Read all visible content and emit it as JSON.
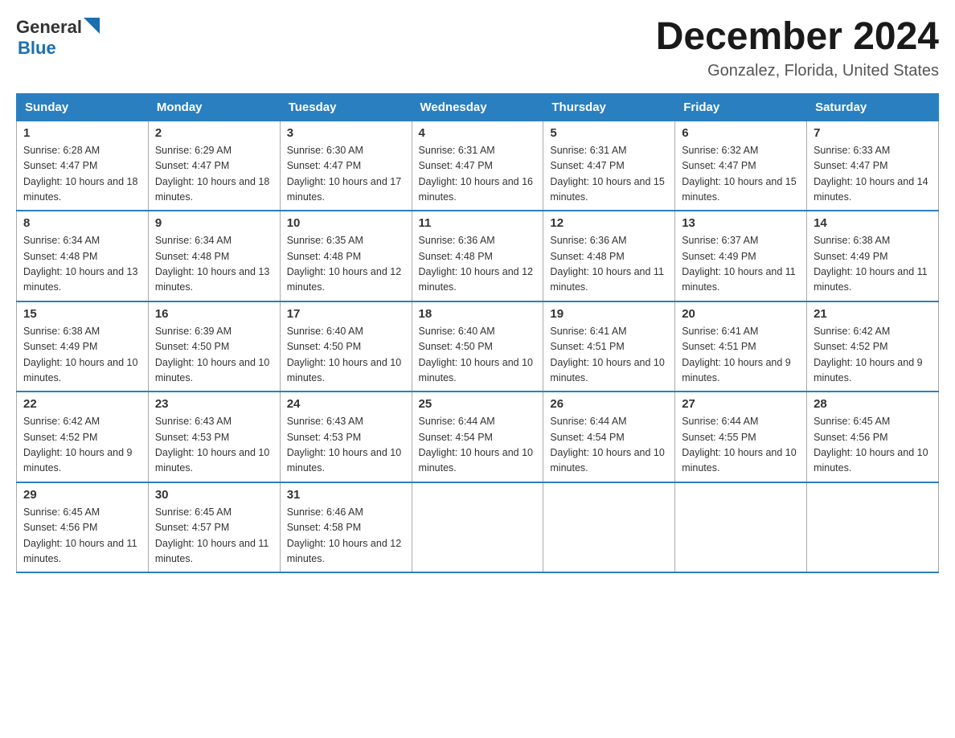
{
  "header": {
    "logo_general": "General",
    "logo_blue": "Blue",
    "month_title": "December 2024",
    "location": "Gonzalez, Florida, United States"
  },
  "days_of_week": [
    "Sunday",
    "Monday",
    "Tuesday",
    "Wednesday",
    "Thursday",
    "Friday",
    "Saturday"
  ],
  "weeks": [
    [
      {
        "day": "1",
        "sunrise": "6:28 AM",
        "sunset": "4:47 PM",
        "daylight": "10 hours and 18 minutes."
      },
      {
        "day": "2",
        "sunrise": "6:29 AM",
        "sunset": "4:47 PM",
        "daylight": "10 hours and 18 minutes."
      },
      {
        "day": "3",
        "sunrise": "6:30 AM",
        "sunset": "4:47 PM",
        "daylight": "10 hours and 17 minutes."
      },
      {
        "day": "4",
        "sunrise": "6:31 AM",
        "sunset": "4:47 PM",
        "daylight": "10 hours and 16 minutes."
      },
      {
        "day": "5",
        "sunrise": "6:31 AM",
        "sunset": "4:47 PM",
        "daylight": "10 hours and 15 minutes."
      },
      {
        "day": "6",
        "sunrise": "6:32 AM",
        "sunset": "4:47 PM",
        "daylight": "10 hours and 15 minutes."
      },
      {
        "day": "7",
        "sunrise": "6:33 AM",
        "sunset": "4:47 PM",
        "daylight": "10 hours and 14 minutes."
      }
    ],
    [
      {
        "day": "8",
        "sunrise": "6:34 AM",
        "sunset": "4:48 PM",
        "daylight": "10 hours and 13 minutes."
      },
      {
        "day": "9",
        "sunrise": "6:34 AM",
        "sunset": "4:48 PM",
        "daylight": "10 hours and 13 minutes."
      },
      {
        "day": "10",
        "sunrise": "6:35 AM",
        "sunset": "4:48 PM",
        "daylight": "10 hours and 12 minutes."
      },
      {
        "day": "11",
        "sunrise": "6:36 AM",
        "sunset": "4:48 PM",
        "daylight": "10 hours and 12 minutes."
      },
      {
        "day": "12",
        "sunrise": "6:36 AM",
        "sunset": "4:48 PM",
        "daylight": "10 hours and 11 minutes."
      },
      {
        "day": "13",
        "sunrise": "6:37 AM",
        "sunset": "4:49 PM",
        "daylight": "10 hours and 11 minutes."
      },
      {
        "day": "14",
        "sunrise": "6:38 AM",
        "sunset": "4:49 PM",
        "daylight": "10 hours and 11 minutes."
      }
    ],
    [
      {
        "day": "15",
        "sunrise": "6:38 AM",
        "sunset": "4:49 PM",
        "daylight": "10 hours and 10 minutes."
      },
      {
        "day": "16",
        "sunrise": "6:39 AM",
        "sunset": "4:50 PM",
        "daylight": "10 hours and 10 minutes."
      },
      {
        "day": "17",
        "sunrise": "6:40 AM",
        "sunset": "4:50 PM",
        "daylight": "10 hours and 10 minutes."
      },
      {
        "day": "18",
        "sunrise": "6:40 AM",
        "sunset": "4:50 PM",
        "daylight": "10 hours and 10 minutes."
      },
      {
        "day": "19",
        "sunrise": "6:41 AM",
        "sunset": "4:51 PM",
        "daylight": "10 hours and 10 minutes."
      },
      {
        "day": "20",
        "sunrise": "6:41 AM",
        "sunset": "4:51 PM",
        "daylight": "10 hours and 9 minutes."
      },
      {
        "day": "21",
        "sunrise": "6:42 AM",
        "sunset": "4:52 PM",
        "daylight": "10 hours and 9 minutes."
      }
    ],
    [
      {
        "day": "22",
        "sunrise": "6:42 AM",
        "sunset": "4:52 PM",
        "daylight": "10 hours and 9 minutes."
      },
      {
        "day": "23",
        "sunrise": "6:43 AM",
        "sunset": "4:53 PM",
        "daylight": "10 hours and 10 minutes."
      },
      {
        "day": "24",
        "sunrise": "6:43 AM",
        "sunset": "4:53 PM",
        "daylight": "10 hours and 10 minutes."
      },
      {
        "day": "25",
        "sunrise": "6:44 AM",
        "sunset": "4:54 PM",
        "daylight": "10 hours and 10 minutes."
      },
      {
        "day": "26",
        "sunrise": "6:44 AM",
        "sunset": "4:54 PM",
        "daylight": "10 hours and 10 minutes."
      },
      {
        "day": "27",
        "sunrise": "6:44 AM",
        "sunset": "4:55 PM",
        "daylight": "10 hours and 10 minutes."
      },
      {
        "day": "28",
        "sunrise": "6:45 AM",
        "sunset": "4:56 PM",
        "daylight": "10 hours and 10 minutes."
      }
    ],
    [
      {
        "day": "29",
        "sunrise": "6:45 AM",
        "sunset": "4:56 PM",
        "daylight": "10 hours and 11 minutes."
      },
      {
        "day": "30",
        "sunrise": "6:45 AM",
        "sunset": "4:57 PM",
        "daylight": "10 hours and 11 minutes."
      },
      {
        "day": "31",
        "sunrise": "6:46 AM",
        "sunset": "4:58 PM",
        "daylight": "10 hours and 12 minutes."
      },
      null,
      null,
      null,
      null
    ]
  ],
  "labels": {
    "sunrise_prefix": "Sunrise: ",
    "sunset_prefix": "Sunset: ",
    "daylight_prefix": "Daylight: "
  }
}
